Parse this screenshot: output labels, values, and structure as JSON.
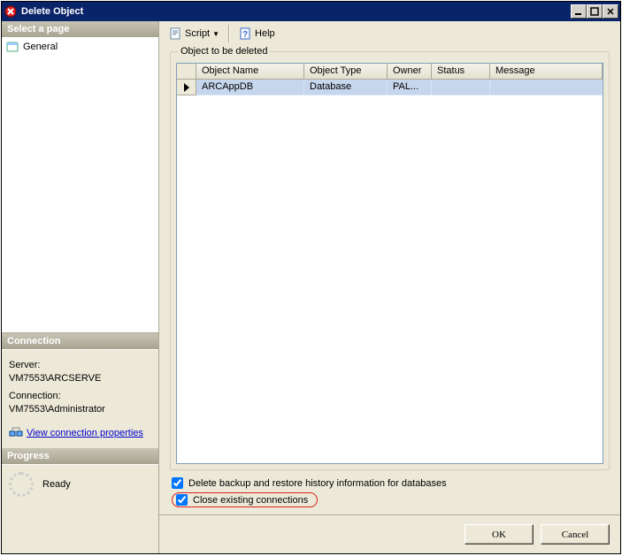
{
  "titlebar": {
    "title": "Delete Object"
  },
  "left": {
    "selectpage_hdr": "Select a page",
    "pages": [
      {
        "label": "General"
      }
    ],
    "connection_hdr": "Connection",
    "server_lbl": "Server:",
    "server_val": "VM7553\\ARCSERVE",
    "conn_lbl": "Connection:",
    "conn_val": "VM7553\\Administrator",
    "view_link": "View connection properties",
    "progress_hdr": "Progress",
    "progress_status": "Ready"
  },
  "toolbar": {
    "script_label": "Script",
    "help_label": "Help"
  },
  "grid": {
    "legend": "Object to be deleted",
    "headers": {
      "name": "Object Name",
      "type": "Object Type",
      "owner": "Owner",
      "status": "Status",
      "message": "Message"
    },
    "rows": [
      {
        "name": "ARCAppDB",
        "type": "Database",
        "owner": "PAL...",
        "status": "",
        "message": ""
      }
    ]
  },
  "options": {
    "delete_backup": "Delete backup and restore history information for databases",
    "close_conn": "Close existing connections"
  },
  "footer": {
    "ok": "OK",
    "cancel": "Cancel"
  }
}
